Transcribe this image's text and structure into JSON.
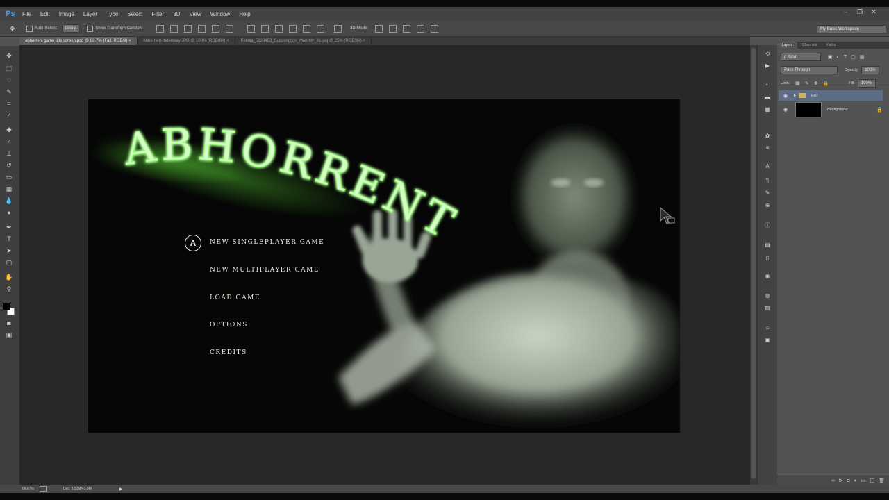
{
  "app": {
    "logo": "Ps"
  },
  "menubar": {
    "items": [
      "File",
      "Edit",
      "Image",
      "Layer",
      "Type",
      "Select",
      "Filter",
      "3D",
      "View",
      "Window",
      "Help"
    ]
  },
  "options": {
    "auto_select_label": "Auto-Select:",
    "auto_select_value": "Group",
    "transform_label": "Show Transform Controls",
    "mode_label": "3D Mode:",
    "workspace": "My Basic Workspace"
  },
  "tabs": [
    "abhorrent game title screen.psd @ 66.7% (Fall, RGB/8)",
    "Abhorrent-tbd/essay.JPG @ 100% (RGB/8#)",
    "Fotolia_5629453_Subscription_Monthly_XL.jpg @ 25% (RGB/8#)"
  ],
  "game": {
    "title": "ABHORRENT",
    "menu": [
      "NEW SINGLEPLAYER GAME",
      "NEW MULTIPLAYER GAME",
      "LOAD GAME",
      "OPTIONS",
      "CREDITS"
    ],
    "accent": "#8cff6a"
  },
  "layers_panel": {
    "tabs": [
      "Layers",
      "Channels",
      "Paths"
    ],
    "kind": "Kind",
    "blend_mode": "Pass Through",
    "opacity_label": "Opacity:",
    "opacity_value": "100%",
    "lock_label": "Lock:",
    "fill_label": "Fill:",
    "fill_value": "100%",
    "layers": [
      {
        "name": "Fall",
        "type": "group",
        "selected": true
      },
      {
        "name": "Background",
        "type": "pixel",
        "locked": true
      }
    ]
  },
  "status": {
    "zoom": "66.67%",
    "doc": "Doc: 3.52M/43.9M"
  },
  "colors": {
    "ui_dark": "#3e3e3e",
    "panel": "#535353",
    "pasteboard": "#282828",
    "ps_blue": "#3a9cf5",
    "glow_green": "#8cff6a"
  }
}
